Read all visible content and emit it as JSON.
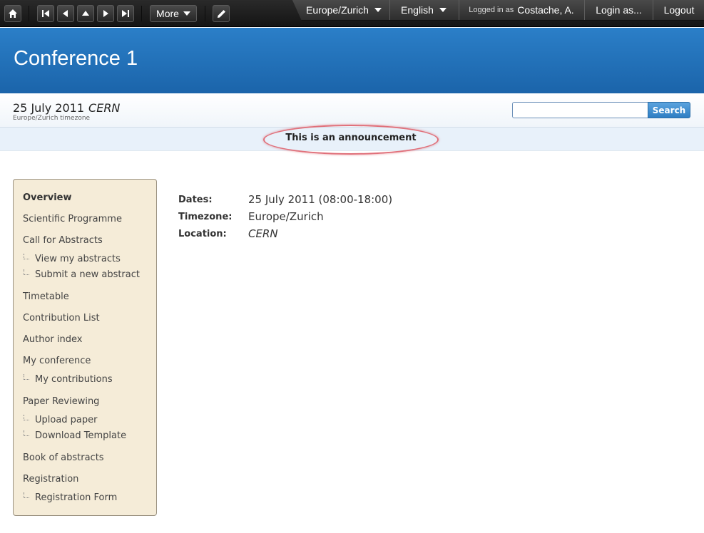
{
  "toolbar": {
    "more_label": "More"
  },
  "userbar": {
    "timezone": "Europe/Zurich",
    "language": "English",
    "logged_in_prefix": "Logged in as",
    "user_name": "Costache, A.",
    "login_as": "Login as...",
    "logout": "Logout"
  },
  "event": {
    "title": "Conference 1",
    "date": "25 July 2011",
    "venue": "CERN",
    "timezone_note": "Europe/Zurich timezone"
  },
  "search": {
    "button_label": "Search",
    "value": ""
  },
  "announcement": "This is an announcement",
  "sidebar": {
    "items": [
      {
        "label": "Overview"
      },
      {
        "label": "Scientific Programme"
      },
      {
        "label": "Call for Abstracts"
      },
      {
        "label": "View my abstracts"
      },
      {
        "label": "Submit a new abstract"
      },
      {
        "label": "Timetable"
      },
      {
        "label": "Contribution List"
      },
      {
        "label": "Author index"
      },
      {
        "label": "My conference"
      },
      {
        "label": "My contributions"
      },
      {
        "label": "Paper Reviewing"
      },
      {
        "label": "Upload paper"
      },
      {
        "label": "Download Template"
      },
      {
        "label": "Book of abstracts"
      },
      {
        "label": "Registration"
      },
      {
        "label": "Registration Form"
      }
    ]
  },
  "details": {
    "dates_label": "Dates:",
    "dates_value": "25 July 2011 (08:00-18:00)",
    "timezone_label": "Timezone:",
    "timezone_value": "Europe/Zurich",
    "location_label": "Location:",
    "location_value": "CERN"
  },
  "colors": {
    "header_blue": "#2272bb",
    "sidebar_bg": "#f5ecd8",
    "announcement_ring": "#e0707a"
  }
}
